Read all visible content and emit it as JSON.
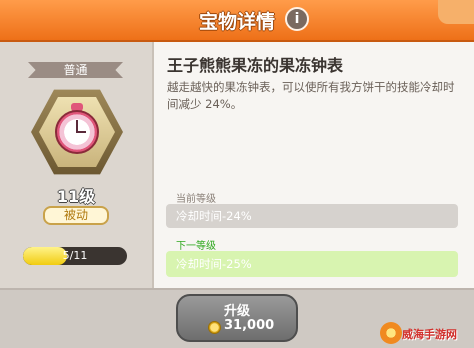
{
  "header": {
    "title": "宝物详情",
    "info_icon": "i"
  },
  "treasure": {
    "rarity": "普通",
    "icon": "clock-icon",
    "level": "11级",
    "type": "被动",
    "progress_text": "5/11",
    "progress_fraction": 0.42
  },
  "skill": {
    "name": "王子熊熊果冻的果冻钟表",
    "description": "越走越快的果冻钟表，可以使所有我方饼干的技能冷却时间减少 24%。"
  },
  "current_level": {
    "label": "当前等级",
    "value": "冷却时间-24%"
  },
  "next_level": {
    "label": "下一等级",
    "value": "冷却时间-25%"
  },
  "upgrade": {
    "label": "升级",
    "cost": "31,000"
  },
  "watermark": {
    "text": "威海手游网"
  },
  "colors": {
    "header": "#ee7018",
    "next_level": "#2ea81e",
    "progress": "#f1cc10"
  }
}
